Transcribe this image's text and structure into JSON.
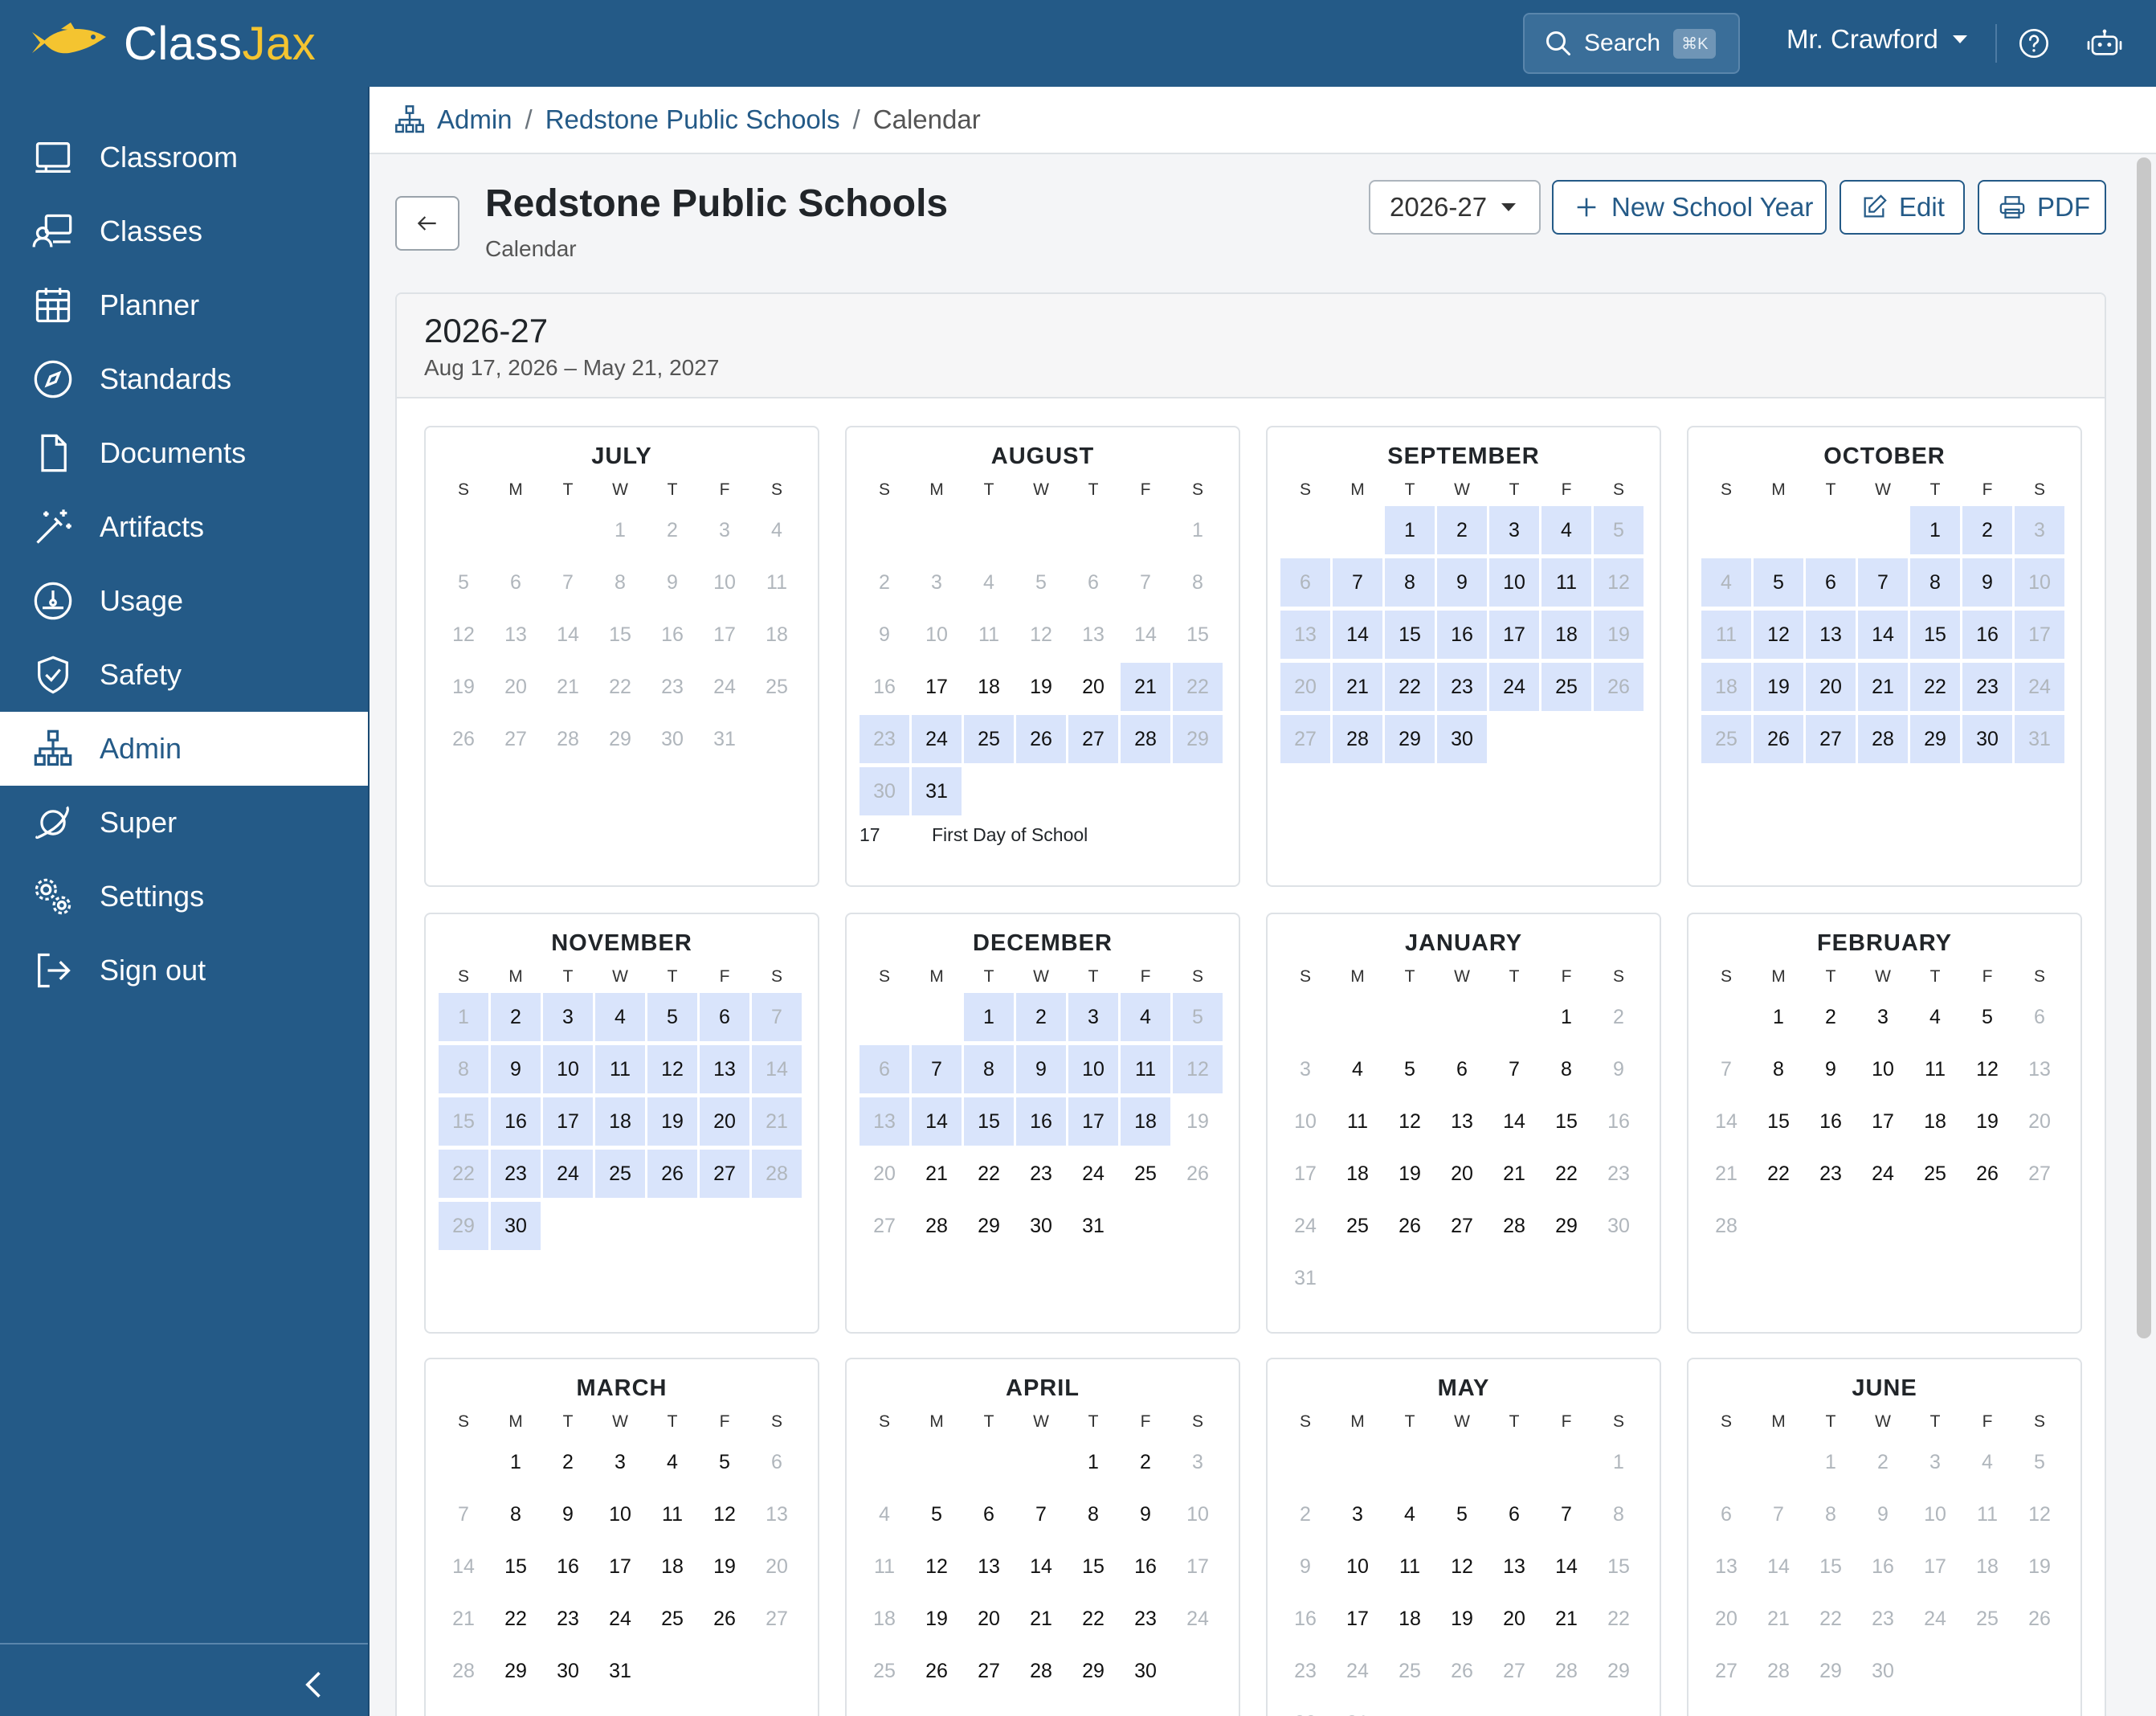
{
  "app": {
    "logo_main": "Class",
    "logo_accent": "Jax",
    "brand_color": "#245a87",
    "accent_color": "#f4c430",
    "search_label": "Search",
    "search_shortcut": "⌘K",
    "user_name": "Mr. Crawford"
  },
  "sidebar": {
    "items": [
      {
        "label": "Classroom",
        "icon": "classroom-icon"
      },
      {
        "label": "Classes",
        "icon": "classes-icon"
      },
      {
        "label": "Planner",
        "icon": "calendar-grid-icon"
      },
      {
        "label": "Standards",
        "icon": "compass-icon"
      },
      {
        "label": "Documents",
        "icon": "document-icon"
      },
      {
        "label": "Artifacts",
        "icon": "magic-wand-icon"
      },
      {
        "label": "Usage",
        "icon": "gauge-icon"
      },
      {
        "label": "Safety",
        "icon": "shield-icon"
      },
      {
        "label": "Admin",
        "icon": "org-chart-icon",
        "active": true
      },
      {
        "label": "Super",
        "icon": "orbit-icon"
      },
      {
        "label": "Settings",
        "icon": "gears-icon"
      },
      {
        "label": "Sign out",
        "icon": "sign-out-icon"
      }
    ]
  },
  "breadcrumb": {
    "items": [
      "Admin",
      "Redstone Public Schools"
    ],
    "current": "Calendar"
  },
  "header": {
    "title": "Redstone Public Schools",
    "subtitle": "Calendar",
    "year_select": "2026-27",
    "new_year_label": "New School Year",
    "edit_label": "Edit",
    "pdf_label": "PDF"
  },
  "calendar": {
    "year": "2026-27",
    "range": "Aug 17, 2026 – May 21, 2027",
    "highlight_color": "#d9e4fb",
    "weekdays": [
      "S",
      "M",
      "T",
      "W",
      "T",
      "F",
      "S"
    ],
    "months": [
      {
        "name": "JULY",
        "start": 3,
        "days": 31,
        "active": [],
        "hl": [],
        "events": []
      },
      {
        "name": "AUGUST",
        "start": 6,
        "days": 31,
        "active": [
          17,
          18,
          19,
          20,
          21,
          24,
          25,
          26,
          27,
          28,
          31
        ],
        "hl": [
          21,
          22,
          23,
          24,
          25,
          26,
          27,
          28,
          29,
          30,
          31
        ],
        "events": [
          {
            "day": "17",
            "text": "First Day of School"
          }
        ]
      },
      {
        "name": "SEPTEMBER",
        "start": 2,
        "days": 30,
        "active": [
          1,
          2,
          3,
          4,
          7,
          8,
          9,
          10,
          11,
          14,
          15,
          16,
          17,
          18,
          21,
          22,
          23,
          24,
          25,
          28,
          29,
          30
        ],
        "hl": "all",
        "events": []
      },
      {
        "name": "OCTOBER",
        "start": 4,
        "days": 31,
        "active": [
          1,
          2,
          5,
          6,
          7,
          8,
          9,
          12,
          13,
          14,
          15,
          16,
          19,
          20,
          21,
          22,
          23,
          26,
          27,
          28,
          29,
          30
        ],
        "hl": "all",
        "events": []
      },
      {
        "name": "NOVEMBER",
        "start": 0,
        "days": 30,
        "active": [
          2,
          3,
          4,
          5,
          6,
          9,
          10,
          11,
          12,
          13,
          16,
          17,
          18,
          19,
          20,
          23,
          24,
          25,
          26,
          27,
          30
        ],
        "hl": "all",
        "events": []
      },
      {
        "name": "DECEMBER",
        "start": 2,
        "days": 31,
        "active": [
          1,
          2,
          3,
          4,
          7,
          8,
          9,
          10,
          11,
          14,
          15,
          16,
          17,
          18,
          21,
          22,
          23,
          24,
          25,
          28,
          29,
          30,
          31
        ],
        "hl": [
          1,
          2,
          3,
          4,
          5,
          6,
          7,
          8,
          9,
          10,
          11,
          12,
          13,
          14,
          15,
          16,
          17,
          18
        ],
        "events": []
      },
      {
        "name": "JANUARY",
        "start": 5,
        "days": 31,
        "active": [
          1,
          4,
          5,
          6,
          7,
          8,
          11,
          12,
          13,
          14,
          15,
          18,
          19,
          20,
          21,
          22,
          25,
          26,
          27,
          28,
          29
        ],
        "hl": [],
        "events": []
      },
      {
        "name": "FEBRUARY",
        "start": 1,
        "days": 28,
        "active": [
          1,
          2,
          3,
          4,
          5,
          8,
          9,
          10,
          11,
          12,
          15,
          16,
          17,
          18,
          19,
          22,
          23,
          24,
          25,
          26
        ],
        "hl": [],
        "events": []
      },
      {
        "name": "MARCH",
        "start": 1,
        "days": 31,
        "active": [
          1,
          2,
          3,
          4,
          5,
          8,
          9,
          10,
          11,
          12,
          15,
          16,
          17,
          18,
          19,
          22,
          23,
          24,
          25,
          26,
          29,
          30,
          31
        ],
        "hl": [],
        "events": []
      },
      {
        "name": "APRIL",
        "start": 4,
        "days": 30,
        "active": [
          1,
          2,
          5,
          6,
          7,
          8,
          9,
          12,
          13,
          14,
          15,
          16,
          19,
          20,
          21,
          22,
          23,
          26,
          27,
          28,
          29,
          30
        ],
        "hl": [],
        "events": []
      },
      {
        "name": "MAY",
        "start": 6,
        "days": 31,
        "active": [
          3,
          4,
          5,
          6,
          7,
          10,
          11,
          12,
          13,
          14,
          17,
          18,
          19,
          20,
          21
        ],
        "hl": [],
        "events": []
      },
      {
        "name": "JUNE",
        "start": 2,
        "days": 30,
        "active": [],
        "hl": [],
        "events": []
      }
    ]
  }
}
